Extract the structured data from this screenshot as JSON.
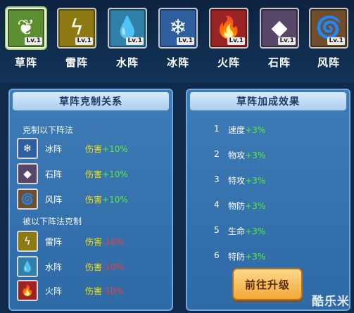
{
  "tabs": [
    {
      "label": "草阵",
      "level": "Lv.1",
      "glyph": "❦",
      "icon": "leaf-icon",
      "color": "#5c8f32"
    },
    {
      "label": "雷阵",
      "level": "Lv.1",
      "glyph": "ϟ",
      "icon": "lightning-icon",
      "color": "#8d7a13"
    },
    {
      "label": "水阵",
      "level": "Lv.1",
      "glyph": "💧",
      "icon": "water-drop-icon",
      "color": "#2f7fa6"
    },
    {
      "label": "冰阵",
      "level": "Lv.1",
      "glyph": "❄",
      "icon": "snowflake-icon",
      "color": "#2f5e9e"
    },
    {
      "label": "火阵",
      "level": "Lv.1",
      "glyph": "🔥",
      "icon": "fire-icon",
      "color": "#9a2323"
    },
    {
      "label": "石阵",
      "level": "Lv.1",
      "glyph": "◆",
      "icon": "rock-icon",
      "color": "#574768"
    },
    {
      "label": "风阵",
      "level": "Lv.1",
      "glyph": "🌀",
      "icon": "tornado-icon",
      "color": "#6e4e2c"
    }
  ],
  "left_panel": {
    "title": "草阵克制关系",
    "counters_title": "克制以下阵法",
    "countered_title": "被以下阵法克制",
    "counters": [
      {
        "name": "冰阵",
        "effect_key": "伤害",
        "effect_value": "+10%",
        "glyph": "❄",
        "icon": "snowflake-icon",
        "color": "#2f5e9e"
      },
      {
        "name": "石阵",
        "effect_key": "伤害",
        "effect_value": "+10%",
        "glyph": "◆",
        "icon": "rock-icon",
        "color": "#574768"
      },
      {
        "name": "风阵",
        "effect_key": "伤害",
        "effect_value": "+10%",
        "glyph": "🌀",
        "icon": "tornado-icon",
        "color": "#6e4e2c"
      }
    ],
    "countered_by": [
      {
        "name": "雷阵",
        "effect_key": "伤害",
        "effect_value": "-10%",
        "glyph": "ϟ",
        "icon": "lightning-icon",
        "color": "#8d7a13"
      },
      {
        "name": "水阵",
        "effect_key": "伤害",
        "effect_value": "-10%",
        "glyph": "💧",
        "icon": "water-drop-icon",
        "color": "#2f7fa6"
      },
      {
        "name": "火阵",
        "effect_key": "伤害",
        "effect_value": "-10%",
        "glyph": "🔥",
        "icon": "fire-icon",
        "color": "#9a2323"
      }
    ]
  },
  "right_panel": {
    "title": "草阵加成效果",
    "bonuses": [
      {
        "num": "1",
        "stat": "速度",
        "value": "+3%"
      },
      {
        "num": "2",
        "stat": "物攻",
        "value": "+3%"
      },
      {
        "num": "3",
        "stat": "特攻",
        "value": "+3%"
      },
      {
        "num": "4",
        "stat": "物防",
        "value": "+3%"
      },
      {
        "num": "5",
        "stat": "生命",
        "value": "+3%"
      },
      {
        "num": "6",
        "stat": "特防",
        "value": "+3%"
      }
    ],
    "upgrade_label": "前往升级"
  },
  "watermark": "酷乐米"
}
